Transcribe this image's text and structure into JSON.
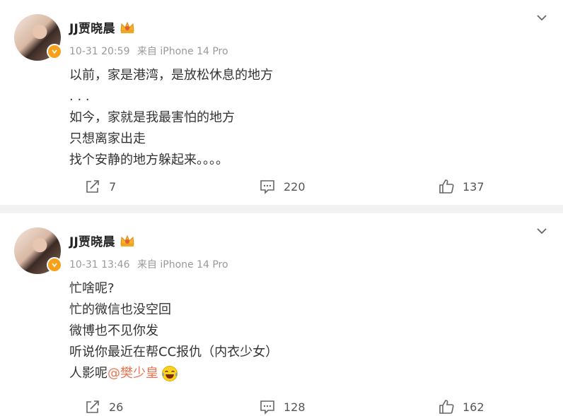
{
  "posts": [
    {
      "author": "JJ贾晓晨",
      "time": "10-31 20:59",
      "source": "来自 iPhone 14 Pro",
      "lines": [
        "以前，家是港湾，是放松休息的地方",
        ". . .",
        "如今，家就是我最害怕的地方",
        "只想离家出走",
        "找个安静的地方躲起来。。。。"
      ],
      "shares": "7",
      "comments": "220",
      "likes": "137"
    },
    {
      "author": "JJ贾晓晨",
      "time": "10-31 13:46",
      "source": "来自 iPhone 14 Pro",
      "lines": [
        "忙啥呢?",
        "忙的微信也没空回",
        "微博也不见你发",
        "听说你最近在帮CC报仇（内衣少女）"
      ],
      "last_line_prefix": "人影呢",
      "mention": "@樊少皇",
      "shares": "26",
      "comments": "128",
      "likes": "162"
    }
  ],
  "icons": {
    "verified": "verified-badge-icon",
    "crown": "crown-badge-icon",
    "share": "share-icon",
    "comment": "comment-icon",
    "like": "thumbs-up-icon",
    "more": "chevron-down-icon",
    "emoji": "laughing-emoji-icon"
  },
  "colors": {
    "mention": "#eb7350",
    "badge": "#f7a11a",
    "meta": "#999999"
  }
}
